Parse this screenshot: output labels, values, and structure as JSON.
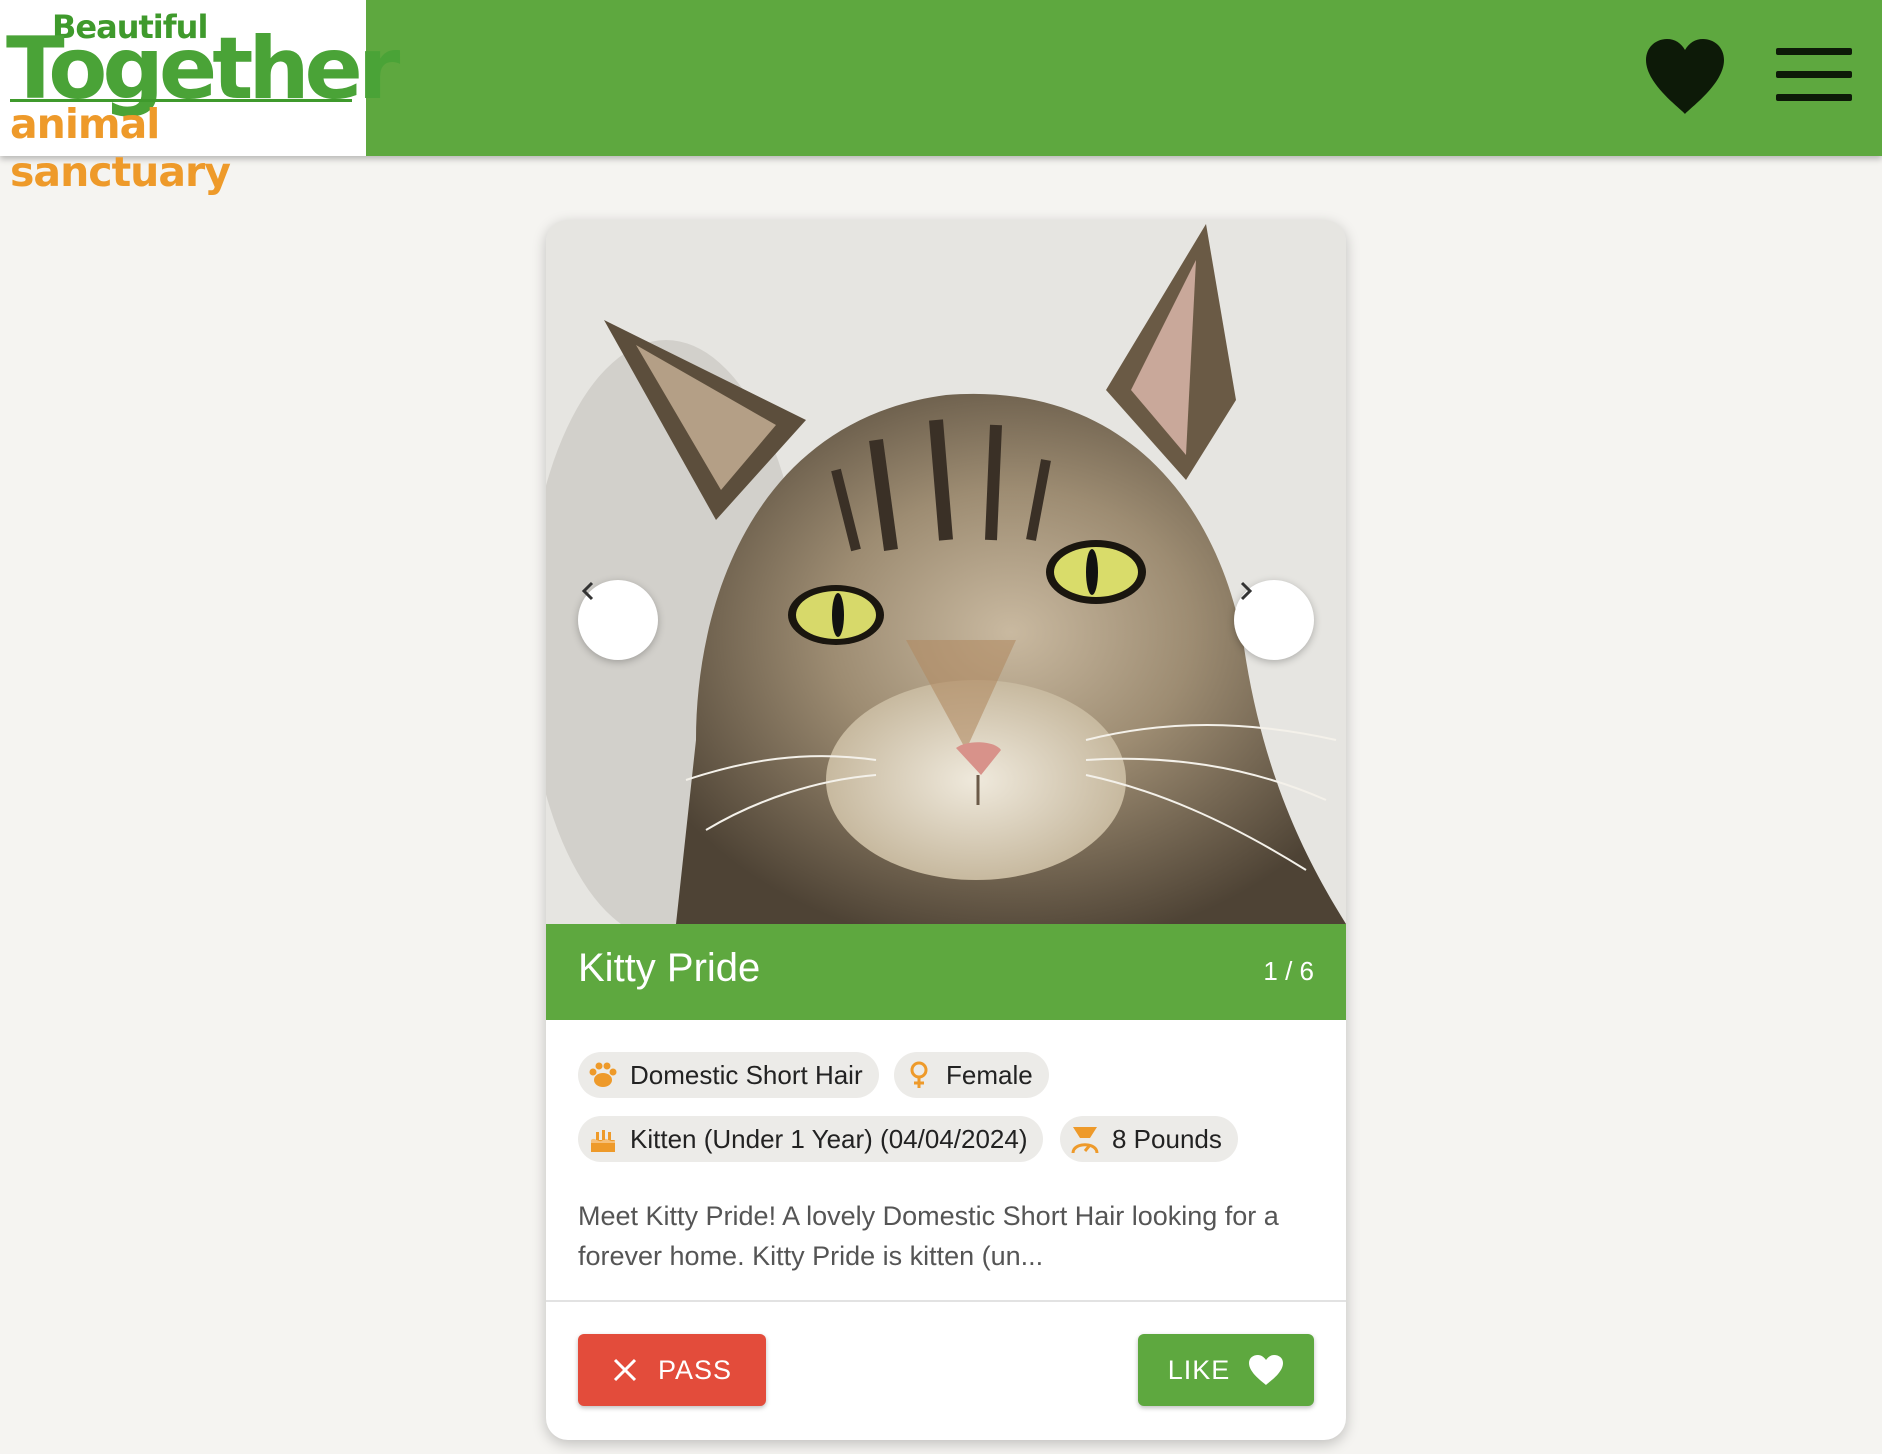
{
  "header": {
    "logo": {
      "line1": "Beautiful",
      "line2": "Together",
      "line3": "animal sanctuary"
    },
    "heart_icon": "heart-icon",
    "menu_icon": "hamburger-menu-icon"
  },
  "card": {
    "pet_name": "Kitty Pride",
    "photo_counter": "1 / 6",
    "attributes": {
      "breed": "Domestic Short Hair",
      "sex": "Female",
      "age": "Kitten (Under 1 Year) (04/04/2024)",
      "weight": "8 Pounds"
    },
    "description": "Meet Kitty Pride! A lovely Domestic Short Hair looking for a forever home. Kitty Pride is kitten (un...",
    "pass_label": "PASS",
    "like_label": "LIKE"
  },
  "colors": {
    "brand_green": "#5ea83f",
    "accent_orange": "#ee9a2a",
    "pass_red": "#e34c3b",
    "header_icon": "#0d1a08"
  }
}
